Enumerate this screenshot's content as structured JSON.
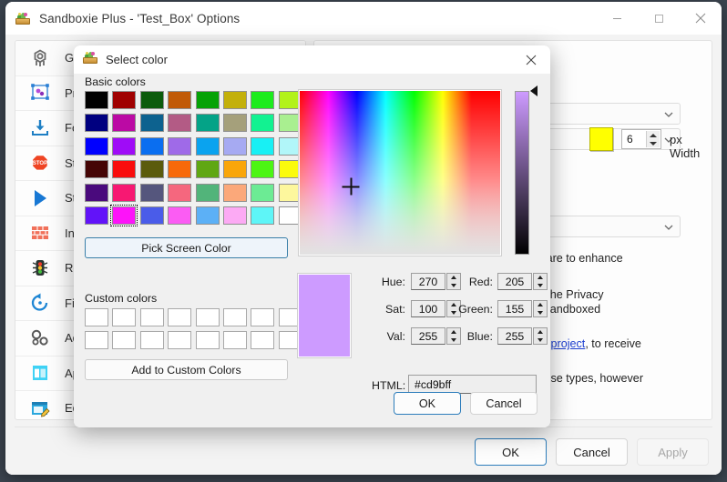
{
  "main_window": {
    "title": "Sandboxie Plus - 'Test_Box' Options",
    "icon": "sandboxie-icon",
    "controls": {
      "minimize": "minimize-icon",
      "maximize": "maximize-icon",
      "close": "close-icon"
    },
    "sidebar": {
      "items": [
        {
          "label": "General",
          "icon": "gear-icon"
        },
        {
          "label": "Programs",
          "icon": "program-group-icon"
        },
        {
          "label": "Force",
          "icon": "download-icon"
        },
        {
          "label": "Stop",
          "icon": "stop-sign-icon"
        },
        {
          "label": "Start",
          "icon": "play-icon"
        },
        {
          "label": "Internet",
          "icon": "brick-wall-icon"
        },
        {
          "label": "Restrictions",
          "icon": "traffic-light-icon"
        },
        {
          "label": "File Recovery",
          "icon": "restore-icon"
        },
        {
          "label": "Advanced",
          "icon": "gears-icon"
        },
        {
          "label": "Appearance",
          "icon": "window-icon"
        },
        {
          "label": "Edit ini",
          "icon": "edit-document-icon"
        }
      ]
    },
    "right_pane": {
      "border_color_swatch": "#ffff00",
      "px_width_value": "6",
      "px_width_label": "px Width",
      "text_fragments": [
        "tware to enhance",
        "s, the Privacy",
        "e sandboxed",
        "he project",
        ", to receive",
        "those types, however"
      ]
    },
    "buttons": {
      "ok": "OK",
      "cancel": "Cancel",
      "apply": "Apply"
    }
  },
  "dialog": {
    "title": "Select color",
    "icon": "sandboxie-icon",
    "close": "close-icon",
    "basic_colors_label": "Basic colors",
    "basic_colors": [
      "#000000",
      "#a00000",
      "#0c5b0c",
      "#c15a07",
      "#06a206",
      "#c3b00a",
      "#1dec1d",
      "#b2f21a",
      "#000080",
      "#bb0aa4",
      "#0d628f",
      "#b35b85",
      "#04a387",
      "#a5a07b",
      "#12f291",
      "#a9ef90",
      "#0000ff",
      "#9f0cf7",
      "#0a6ef0",
      "#9f6ae8",
      "#0aa3ef",
      "#a6aaf2",
      "#18f0f4",
      "#b1f6f9",
      "#450505",
      "#f90d0d",
      "#5b5b0c",
      "#f7690a",
      "#60a713",
      "#f9a60a",
      "#4cf513",
      "#fbfb0c",
      "#4a0a7d",
      "#f71872",
      "#55567d",
      "#f5677e",
      "#52b47a",
      "#fba87a",
      "#6ceb94",
      "#fdf79d",
      "#6213f9",
      "#fd13f9",
      "#4a5ce9",
      "#fb5cf3",
      "#5cb0f6",
      "#fcaaf4",
      "#5ef5f7",
      "#ffffff"
    ],
    "selected_basic_index": 41,
    "pick_screen_color": "Pick Screen Color",
    "custom_colors_label": "Custom colors",
    "custom_colors": [
      "#ffffff",
      "#ffffff",
      "#ffffff",
      "#ffffff",
      "#ffffff",
      "#ffffff",
      "#ffffff",
      "#ffffff",
      "#ffffff",
      "#ffffff",
      "#ffffff",
      "#ffffff",
      "#ffffff",
      "#ffffff",
      "#ffffff",
      "#ffffff"
    ],
    "add_to_custom_colors": "Add to Custom Colors",
    "preview_color": "#cd9bff",
    "fields": {
      "hue_label": "Hue:",
      "hue_value": "270",
      "sat_label": "Sat:",
      "sat_value": "100",
      "val_label": "Val:",
      "val_value": "255",
      "red_label": "Red:",
      "red_value": "205",
      "green_label": "Green:",
      "green_value": "155",
      "blue_label": "Blue:",
      "blue_value": "255",
      "html_label": "HTML:",
      "html_value": "#cd9bff"
    },
    "buttons": {
      "ok": "OK",
      "cancel": "Cancel"
    }
  }
}
